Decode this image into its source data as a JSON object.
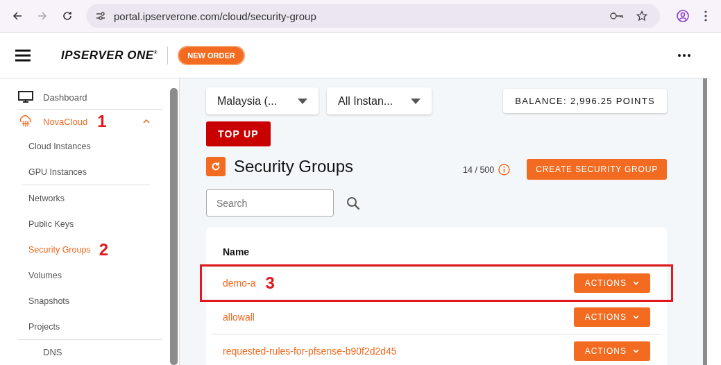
{
  "browser": {
    "nav": [
      {
        "kind": "back",
        "disabled": false
      },
      {
        "kind": "forward",
        "disabled": true
      },
      {
        "kind": "reload",
        "disabled": false
      }
    ],
    "url": "portal.ipserverone.com/cloud/security-group"
  },
  "header": {
    "logo": "IPSERVER ONE",
    "logo_mark": "®",
    "new_order": "NEW ORDER"
  },
  "sidebar": {
    "items": [
      {
        "label": "Dashboard",
        "selected": false,
        "divider_before": false
      },
      {
        "label": "NovaCloud",
        "selected": true,
        "expanded": true,
        "annotation": "1",
        "divider_before": true,
        "children": [
          {
            "label": "Cloud Instances",
            "selected": false,
            "divider_before": false
          },
          {
            "label": "GPU Instances",
            "selected": false,
            "divider_before": false
          },
          {
            "label": "Networks",
            "selected": false,
            "divider_before": true
          },
          {
            "label": "Public Keys",
            "selected": false,
            "divider_before": false
          },
          {
            "label": "Security Groups",
            "selected": true,
            "annotation": "2",
            "divider_before": false
          },
          {
            "label": "Volumes",
            "selected": false,
            "divider_before": false
          },
          {
            "label": "Snapshots",
            "selected": false,
            "divider_before": false
          },
          {
            "label": "Projects",
            "selected": false,
            "divider_before": false
          }
        ]
      },
      {
        "label": "DNS",
        "selected": false,
        "divider_before": true
      }
    ]
  },
  "filters": [
    {
      "value": "Malaysia (..."
    },
    {
      "value": "All Instan..."
    }
  ],
  "balance": "BALANCE: 2,996.25 POINTS",
  "top_up": "TOP UP",
  "title": "Security Groups",
  "quota": "14 / 500",
  "create_button": "CREATE SECURITY GROUP",
  "search": {
    "placeholder": "Search"
  },
  "table": {
    "columns": [
      "Name"
    ],
    "rows": [
      {
        "name": "demo-a",
        "action": "ACTIONS",
        "highlighted": true,
        "annotation": "3"
      },
      {
        "name": "allowall",
        "action": "ACTIONS",
        "highlighted": false
      },
      {
        "name": "requested-rules-for-pfsense-b90f2d2d45",
        "action": "ACTIONS",
        "highlighted": false
      }
    ]
  }
}
